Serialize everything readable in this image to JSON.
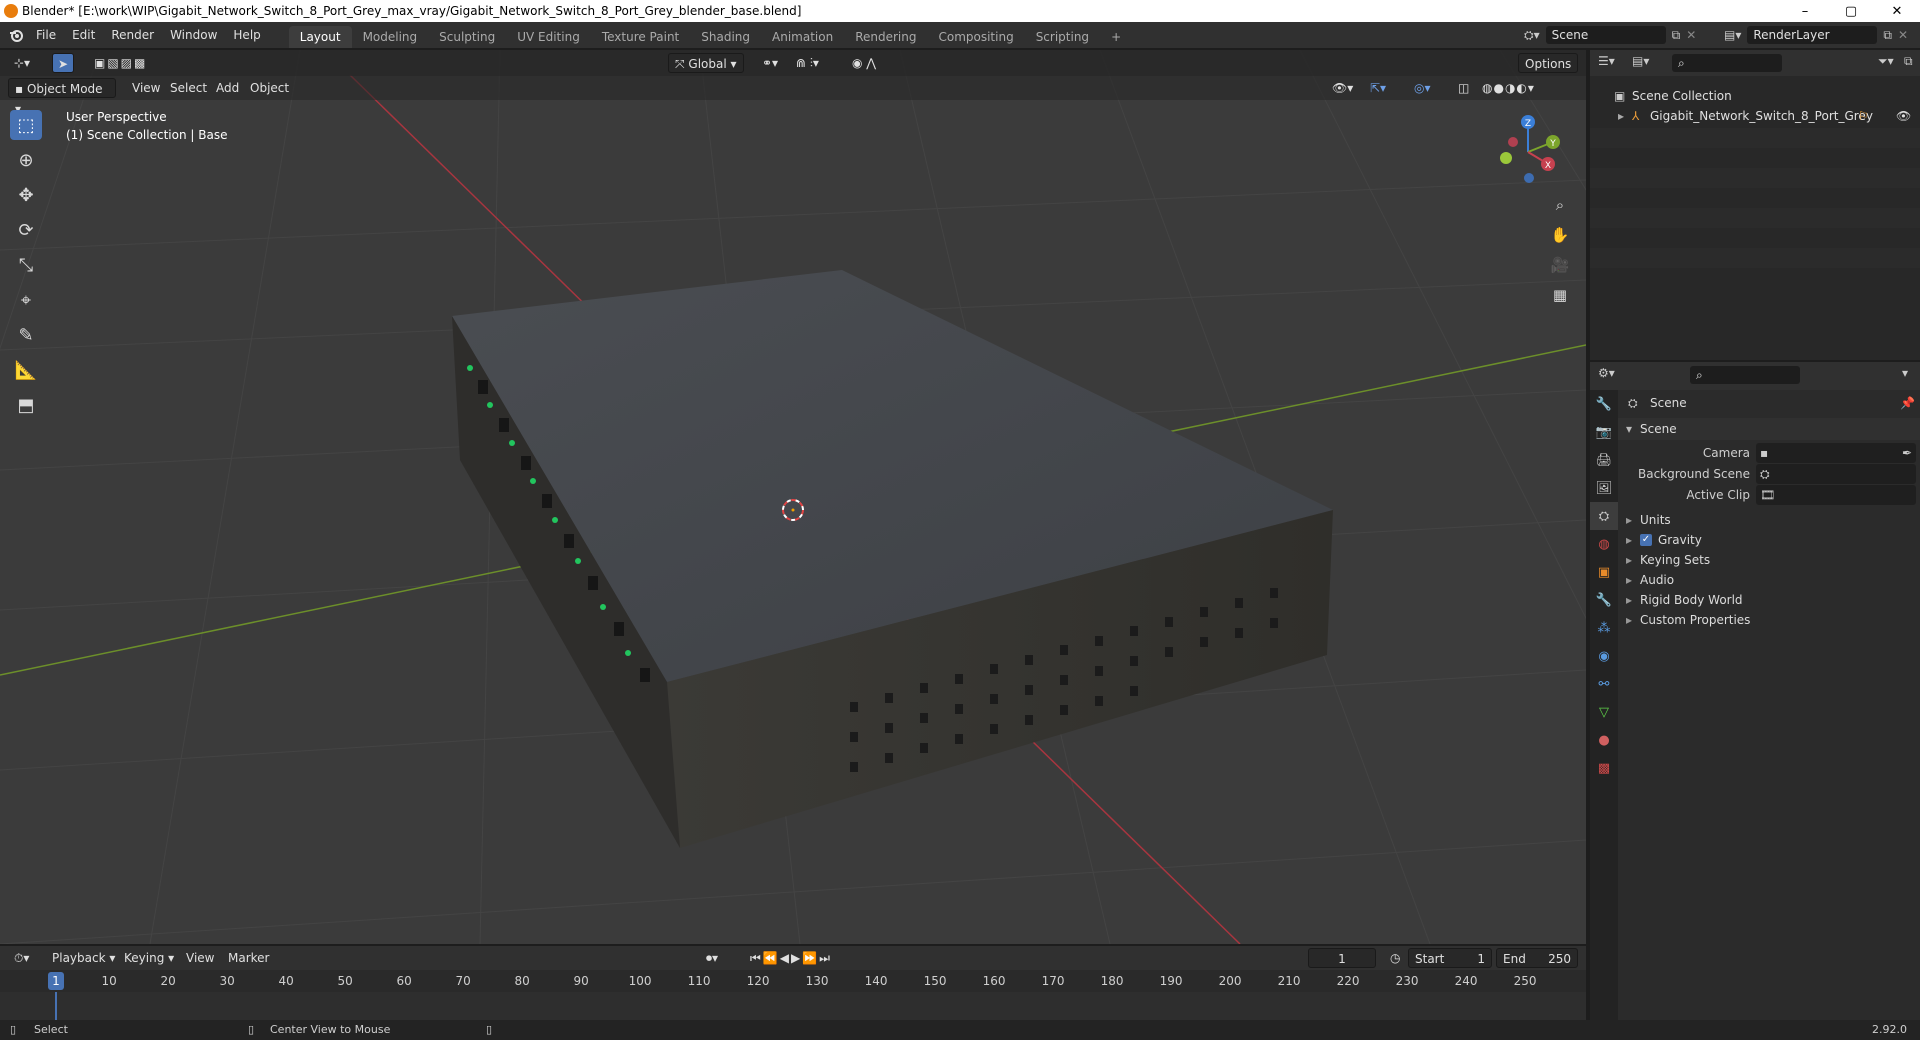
{
  "window": {
    "title": "Blender* [E:\\work\\WIP\\Gigabit_Network_Switch_8_Port_Grey_max_vray/Gigabit_Network_Switch_8_Port_Grey_blender_base.blend]",
    "minimize": "–",
    "maximize": "▢",
    "close": "✕"
  },
  "menubar": {
    "items": [
      "File",
      "Edit",
      "Render",
      "Window",
      "Help"
    ],
    "workspaces": [
      "Layout",
      "Modeling",
      "Sculpting",
      "UV Editing",
      "Texture Paint",
      "Shading",
      "Animation",
      "Rendering",
      "Compositing",
      "Scripting"
    ],
    "add_workspace": "+",
    "scene_label": "Scene",
    "renderlayer_label": "RenderLayer"
  },
  "viewport": {
    "mode": "Object Mode",
    "menus": [
      "View",
      "Select",
      "Add",
      "Object"
    ],
    "transform_orientation": "Global",
    "options": "Options",
    "overlay_title": "User Perspective",
    "overlay_sub": "(1) Scene Collection | Base",
    "gizmo": {
      "z": "Z",
      "y": "Y",
      "x": "X"
    }
  },
  "outliner": {
    "root": "Scene Collection",
    "object": "Gigabit_Network_Switch_8_Port_Grey"
  },
  "properties": {
    "header": "Scene",
    "section": "Scene",
    "fields": [
      {
        "label": "Camera"
      },
      {
        "label": "Background Scene"
      },
      {
        "label": "Active Clip"
      }
    ],
    "panels": [
      "Units",
      "Gravity",
      "Keying Sets",
      "Audio",
      "Rigid Body World",
      "Custom Properties"
    ],
    "gravity_checked": true
  },
  "timeline": {
    "menus": [
      "Playback",
      "Keying",
      "View",
      "Marker"
    ],
    "current_frame": "1",
    "start_label": "Start",
    "start": "1",
    "end_label": "End",
    "end": "250",
    "ticks": [
      "1",
      "10",
      "20",
      "30",
      "40",
      "50",
      "60",
      "70",
      "80",
      "90",
      "100",
      "110",
      "120",
      "130",
      "140",
      "150",
      "160",
      "170",
      "180",
      "190",
      "200",
      "210",
      "220",
      "230",
      "240",
      "250"
    ]
  },
  "statusbar": {
    "left": "Select",
    "middle": "Center View to Mouse",
    "version": "2.92.0"
  },
  "colors": {
    "accent": "#4772b3",
    "x_axis": "#c6414f",
    "y_axis": "#7ca52c",
    "z_axis": "#3b7fd8"
  }
}
